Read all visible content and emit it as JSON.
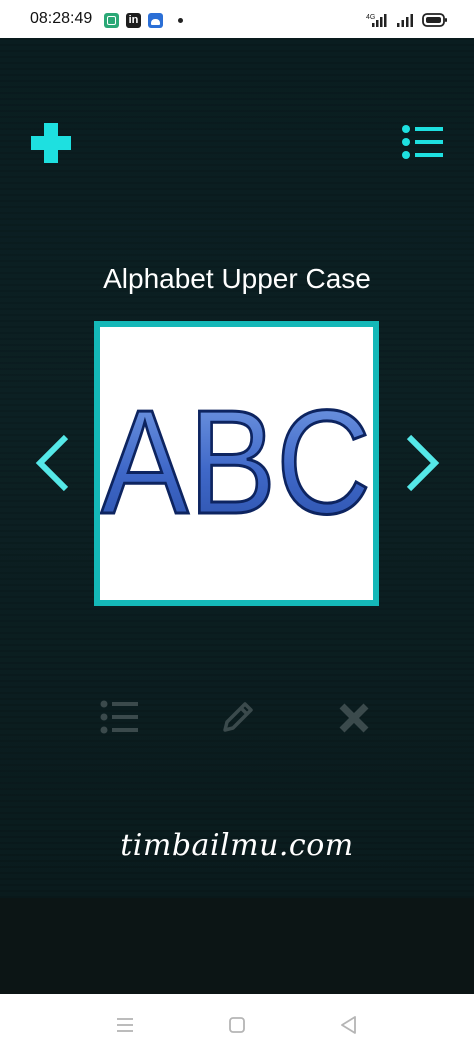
{
  "status_bar": {
    "time": "08:28:49",
    "app_icons": [
      "gallery-app-icon",
      "linkedin-icon",
      "android-app-icon"
    ],
    "network_label": "4G",
    "signal_icons": [
      "signal-icon-1",
      "signal-icon-2",
      "battery-icon"
    ]
  },
  "toolbar": {
    "add_icon": "plus-icon",
    "menu_icon": "list-icon",
    "accent_color": "#1ee0e0"
  },
  "main": {
    "title": "Alphabet Upper Case",
    "image_text": "ABC",
    "prev_icon": "chevron-left-icon",
    "next_icon": "chevron-right-icon",
    "card_border_color": "#14b8b8"
  },
  "actions": {
    "items": [
      {
        "icon": "list-icon"
      },
      {
        "icon": "pencil-icon"
      },
      {
        "icon": "close-icon"
      }
    ],
    "disabled_color": "#3b4a4c"
  },
  "watermark": "timbailmu.com",
  "navbar": {
    "items": [
      "menu-icon",
      "home-icon",
      "back-icon"
    ]
  }
}
